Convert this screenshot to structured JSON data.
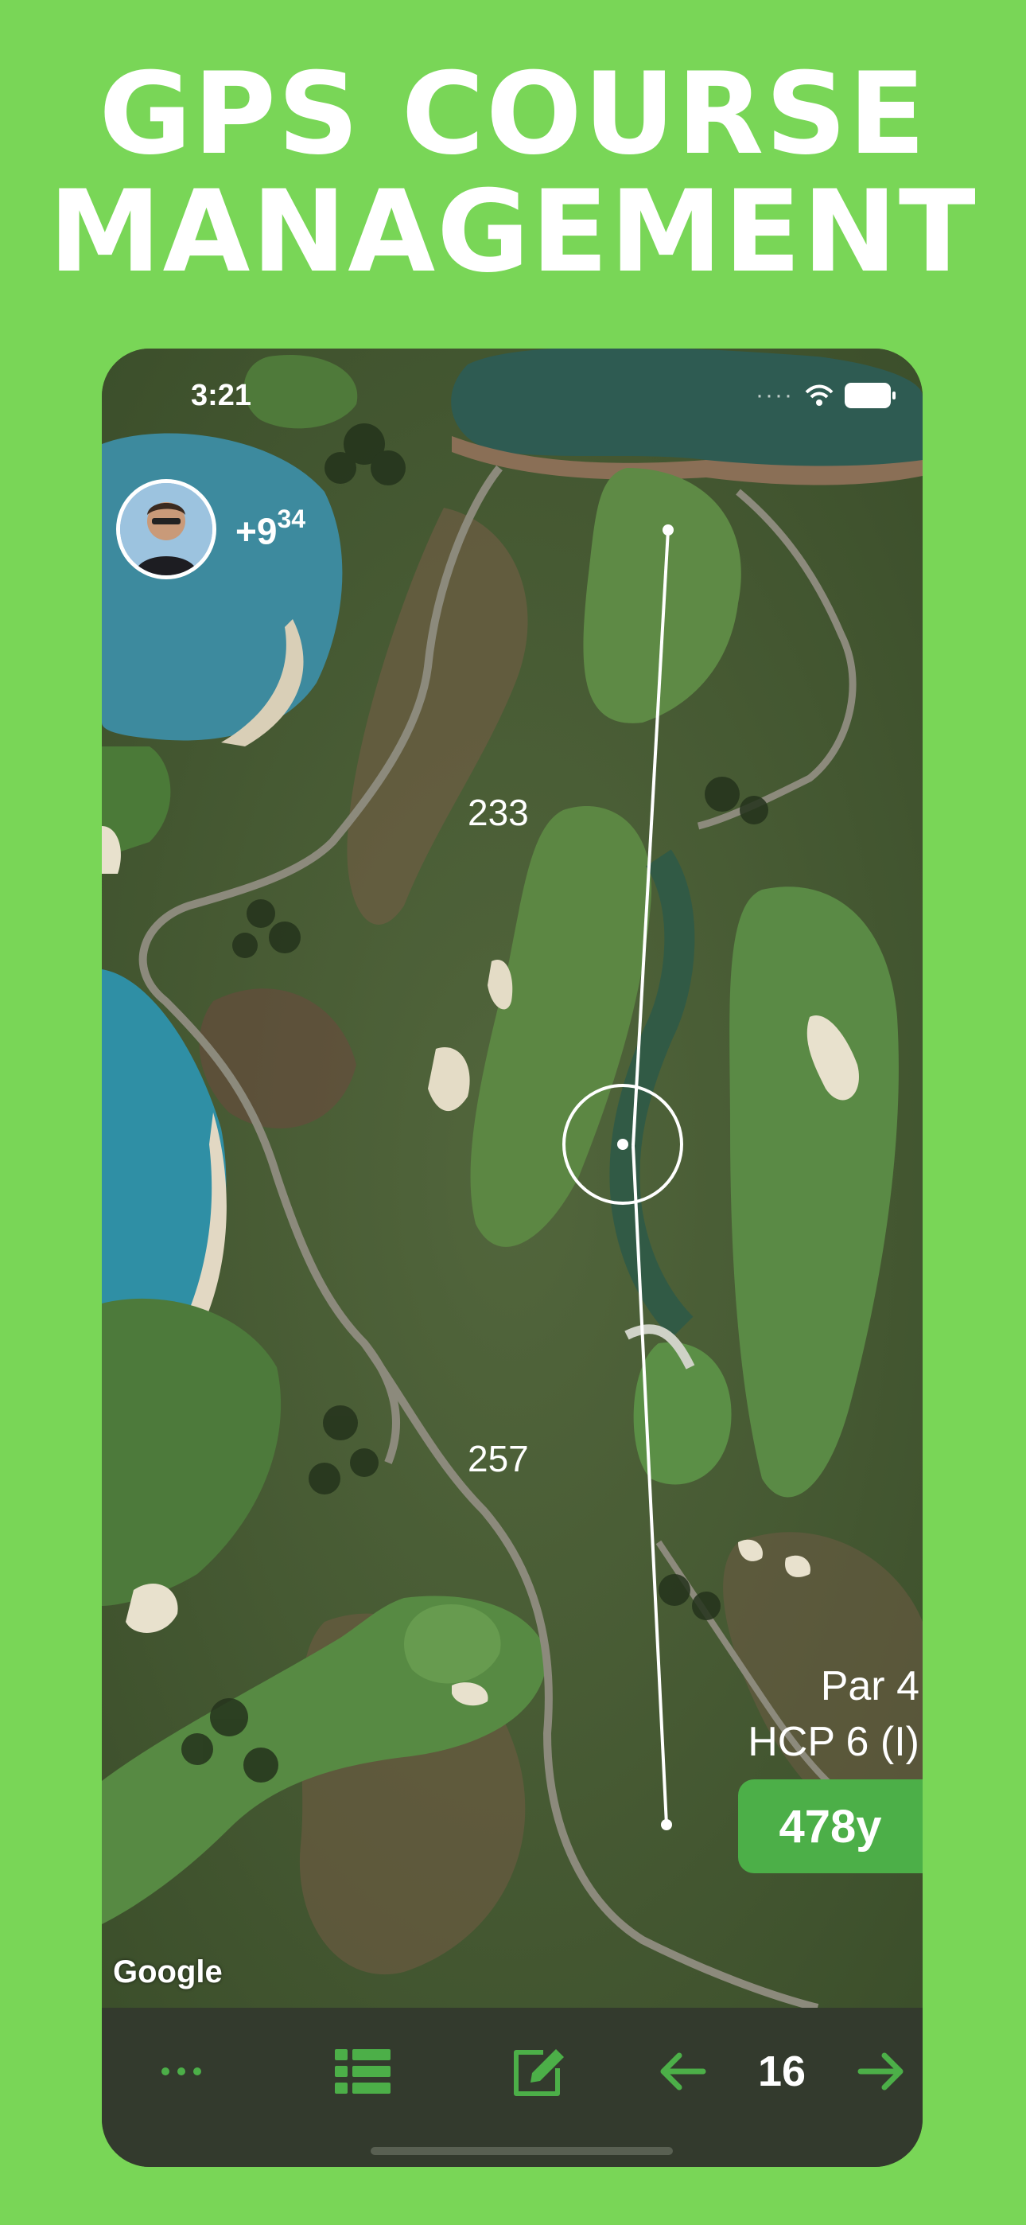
{
  "headline": {
    "line1": "GPS COURSE",
    "line2": "MANAGEMENT"
  },
  "status_bar": {
    "time": "3:21",
    "signal_dots": "····"
  },
  "player": {
    "score_main": "+9",
    "score_super": "34"
  },
  "distances": {
    "first": "233",
    "second": "257"
  },
  "hole": {
    "par": "Par 4",
    "hcp": "HCP 6 (I)",
    "yardage": "478y",
    "number": "16"
  },
  "map": {
    "attribution": "Google"
  },
  "toolbar": {
    "more_icon": "ellipsis-icon",
    "list_icon": "list-icon",
    "edit_icon": "edit-icon",
    "prev_icon": "arrow-left-icon",
    "next_icon": "arrow-right-icon"
  },
  "colors": {
    "background": "#79d657",
    "accent": "#4caf48",
    "toolbar": "#333a2d"
  }
}
